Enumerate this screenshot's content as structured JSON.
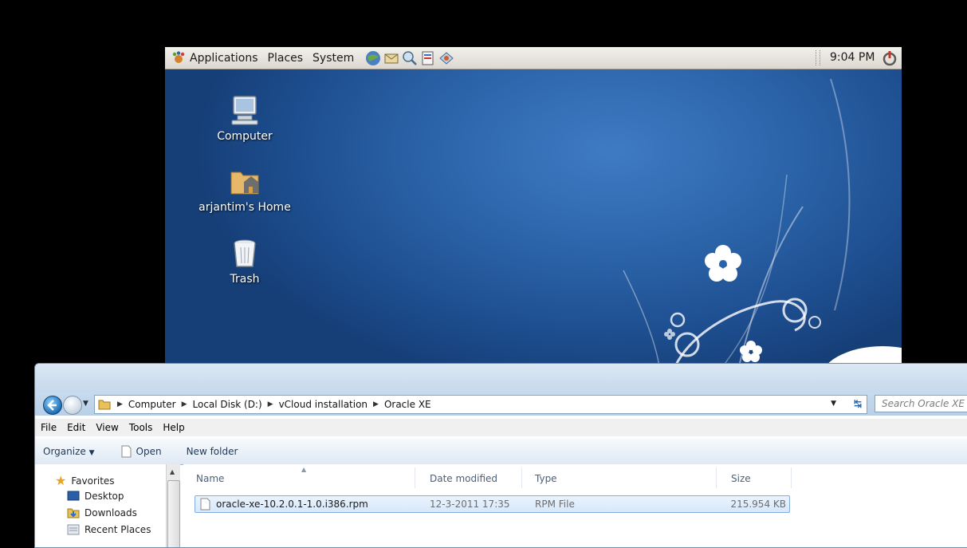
{
  "gnome": {
    "panel": {
      "menus": [
        "Applications",
        "Places",
        "System"
      ],
      "launchers": [
        "web-browser-icon",
        "email-icon",
        "network-icon",
        "notes-icon",
        "help-icon"
      ],
      "clock": "9:04 PM"
    },
    "desktop_icons": [
      {
        "label": "Computer",
        "icon": "computer-icon"
      },
      {
        "label": "arjantim's Home",
        "icon": "home-folder-icon"
      },
      {
        "label": "Trash",
        "icon": "trash-icon"
      }
    ]
  },
  "explorer": {
    "breadcrumb": [
      "Computer",
      "Local Disk (D:)",
      "vCloud installation",
      "Oracle XE"
    ],
    "search_placeholder": "Search Oracle XE",
    "menubar": [
      "File",
      "Edit",
      "View",
      "Tools",
      "Help"
    ],
    "toolbar": {
      "organize_label": "Organize",
      "open_label": "Open",
      "new_folder_label": "New folder"
    },
    "navpane": {
      "favorites_label": "Favorites",
      "items": [
        "Desktop",
        "Downloads",
        "Recent Places"
      ]
    },
    "columns": [
      "Name",
      "Date modified",
      "Type",
      "Size"
    ],
    "files": [
      {
        "name": "oracle-xe-10.2.0.1-1.0.i386.rpm",
        "date_modified": "12-3-2011 17:35",
        "type": "RPM File",
        "size": "215.954 KB"
      }
    ]
  },
  "colors": {
    "desktop_blue": "#2b63a8",
    "panel_gray": "#dcd8d1",
    "selection": "#d7e8fb"
  }
}
